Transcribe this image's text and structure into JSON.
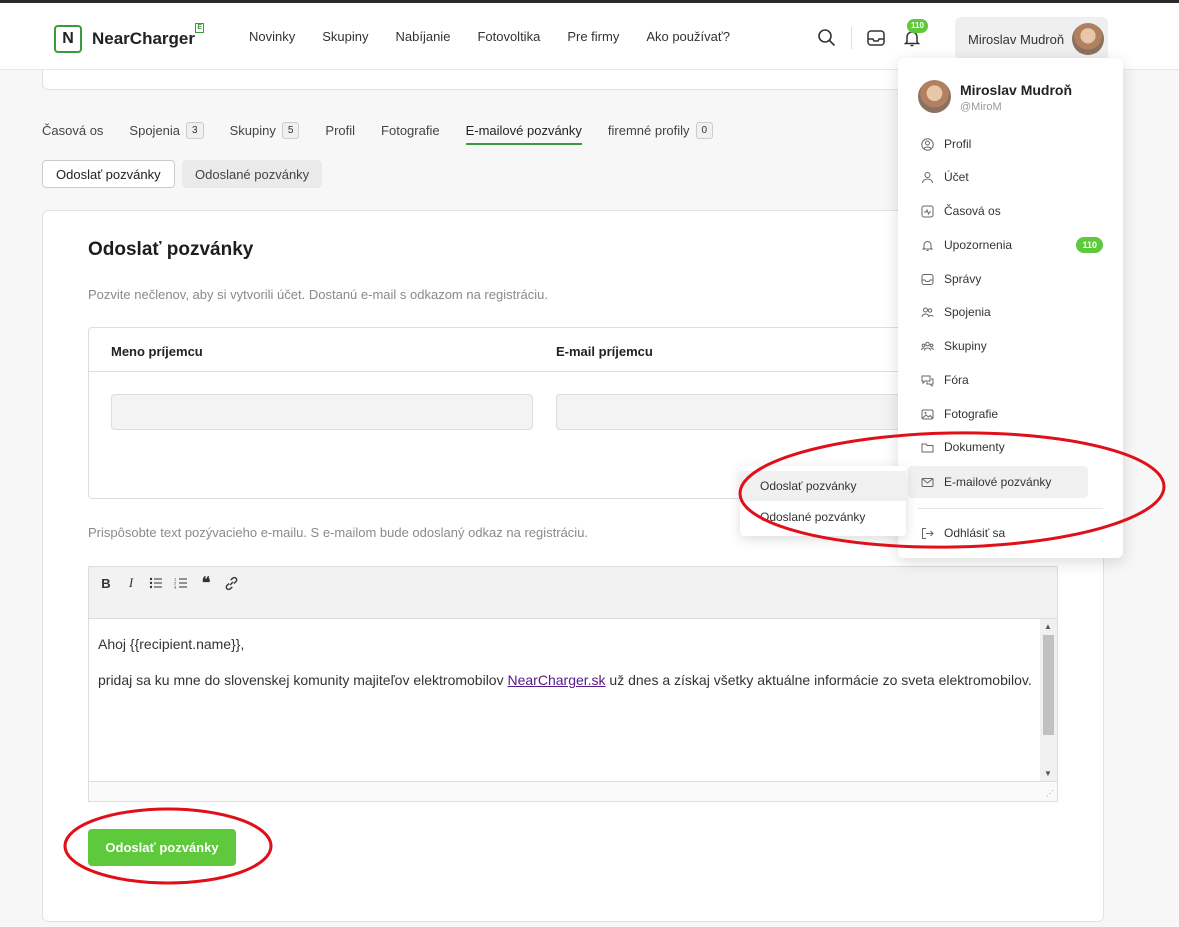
{
  "brand": {
    "name": "NearCharger",
    "badge": "E",
    "logo_letter": "N"
  },
  "nav": [
    "Novinky",
    "Skupiny",
    "Nabíjanie",
    "Fotovoltika",
    "Pre firmy",
    "Ako používať?"
  ],
  "header": {
    "notifications_count": "110",
    "user_name": "Miroslav Mudroň"
  },
  "profile_tabs": [
    {
      "label": "Časová os",
      "count": ""
    },
    {
      "label": "Spojenia",
      "count": "3"
    },
    {
      "label": "Skupiny",
      "count": "5"
    },
    {
      "label": "Profil",
      "count": ""
    },
    {
      "label": "Fotografie",
      "count": ""
    },
    {
      "label": "E-mailové pozvánky",
      "count": "",
      "active": true
    },
    {
      "label": "firemné profily",
      "count": "0"
    }
  ],
  "subtabs": {
    "send": "Odoslať pozvánky",
    "sent": "Odoslané pozvánky"
  },
  "invite_form": {
    "title": "Odoslať pozvánky",
    "description": "Pozvite nečlenov, aby si vytvorili účet. Dostanú e-mail s odkazom na registráciu.",
    "col_name": "Meno príjemcu",
    "col_email": "E-mail príjemcu",
    "name_value": "",
    "email_value": "",
    "customize_text": "Prispôsobte text pozývacieho e-mailu. S e-mailom bude odoslaný odkaz na registráciu.",
    "toolbar": {
      "bold": "B",
      "italic": "I",
      "bullets": "☰",
      "numbered": "☷",
      "quote": "❝",
      "link": "🔗"
    },
    "message_line1": "Ahoj {{recipient.name}},",
    "message_line2_before": "pridaj sa ku mne do slovenskej komunity majiteľov elektromobilov ",
    "message_link": "NearCharger.sk",
    "message_line2_after": " už dnes a získaj všetky aktuálne informácie zo sveta elektromobilov.",
    "submit_label": "Odoslať pozvánky"
  },
  "dropdown": {
    "name": "Miroslav Mudroň",
    "handle": "@MiroM",
    "items": [
      {
        "label": "Profil",
        "icon": "user-circle-icon"
      },
      {
        "label": "Účet",
        "icon": "user-icon"
      },
      {
        "label": "Časová os",
        "icon": "activity-icon"
      },
      {
        "label": "Upozornenia",
        "icon": "bell-icon",
        "badge": "110"
      },
      {
        "label": "Správy",
        "icon": "inbox-icon"
      },
      {
        "label": "Spojenia",
        "icon": "users-icon"
      },
      {
        "label": "Skupiny",
        "icon": "group-icon"
      },
      {
        "label": "Fóra",
        "icon": "chat-icon"
      },
      {
        "label": "Fotografie",
        "icon": "image-icon"
      },
      {
        "label": "Dokumenty",
        "icon": "folder-icon"
      },
      {
        "label": "E-mailové pozvánky",
        "icon": "mail-icon"
      }
    ],
    "logout": "Odhlásiť sa",
    "submenu": [
      "Odoslať pozvánky",
      "Odoslané pozvánky"
    ]
  },
  "colors": {
    "brand_green": "#5dc93b",
    "annotation_red": "#e0101a"
  }
}
